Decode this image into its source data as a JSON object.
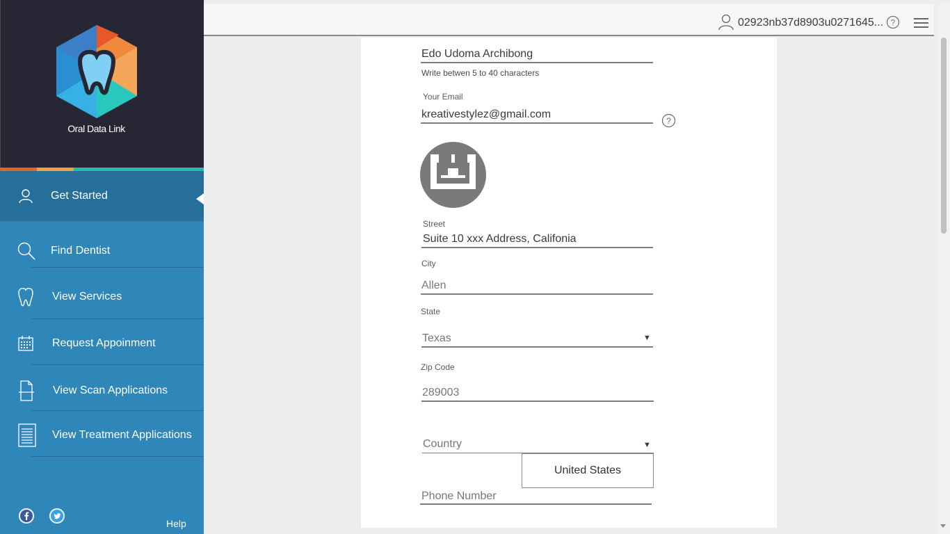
{
  "app": {
    "logo_text": "Oral Data Link"
  },
  "sidebar": {
    "items": [
      {
        "label": "Get Started",
        "icon": "user-icon",
        "active": true
      },
      {
        "label": "Find Dentist",
        "icon": "search-icon"
      },
      {
        "label": "View Services",
        "icon": "tooth-icon"
      },
      {
        "label": "Request Appoinment",
        "icon": "calendar-icon"
      },
      {
        "label": "View Scan Applications",
        "icon": "scan-document-icon"
      },
      {
        "label": "View Treatment Applications",
        "icon": "list-document-icon"
      }
    ],
    "help_label": "Help",
    "social": [
      "facebook-icon",
      "twitter-icon"
    ]
  },
  "topbar": {
    "user_id": "02923nb37d8903u0271645..."
  },
  "form": {
    "name_value": "Edo Udoma Archibong",
    "name_hint": "Write betwen 5 to 40 characters",
    "email_label": "Your Email",
    "email_value": "kreativestylez@gmail.com",
    "street_label": "Street",
    "street_value": "Suite 10 xxx Address, Califonia",
    "city_label": "City",
    "city_value": "Allen",
    "state_label": "State",
    "state_value": "Texas",
    "zip_label": "Zip Code",
    "zip_value": "289003",
    "country_placeholder": "Country",
    "country_option": "United States",
    "phone_placeholder": "Phone Number"
  },
  "colors": {
    "sidebar": "#2f86b9",
    "sidebar_active": "#276f9b",
    "logo_bg": "#272634",
    "bar_orange": "#e2622b",
    "bar_yellow": "#f1a13a",
    "bar_teal": "#2ab8b0"
  }
}
